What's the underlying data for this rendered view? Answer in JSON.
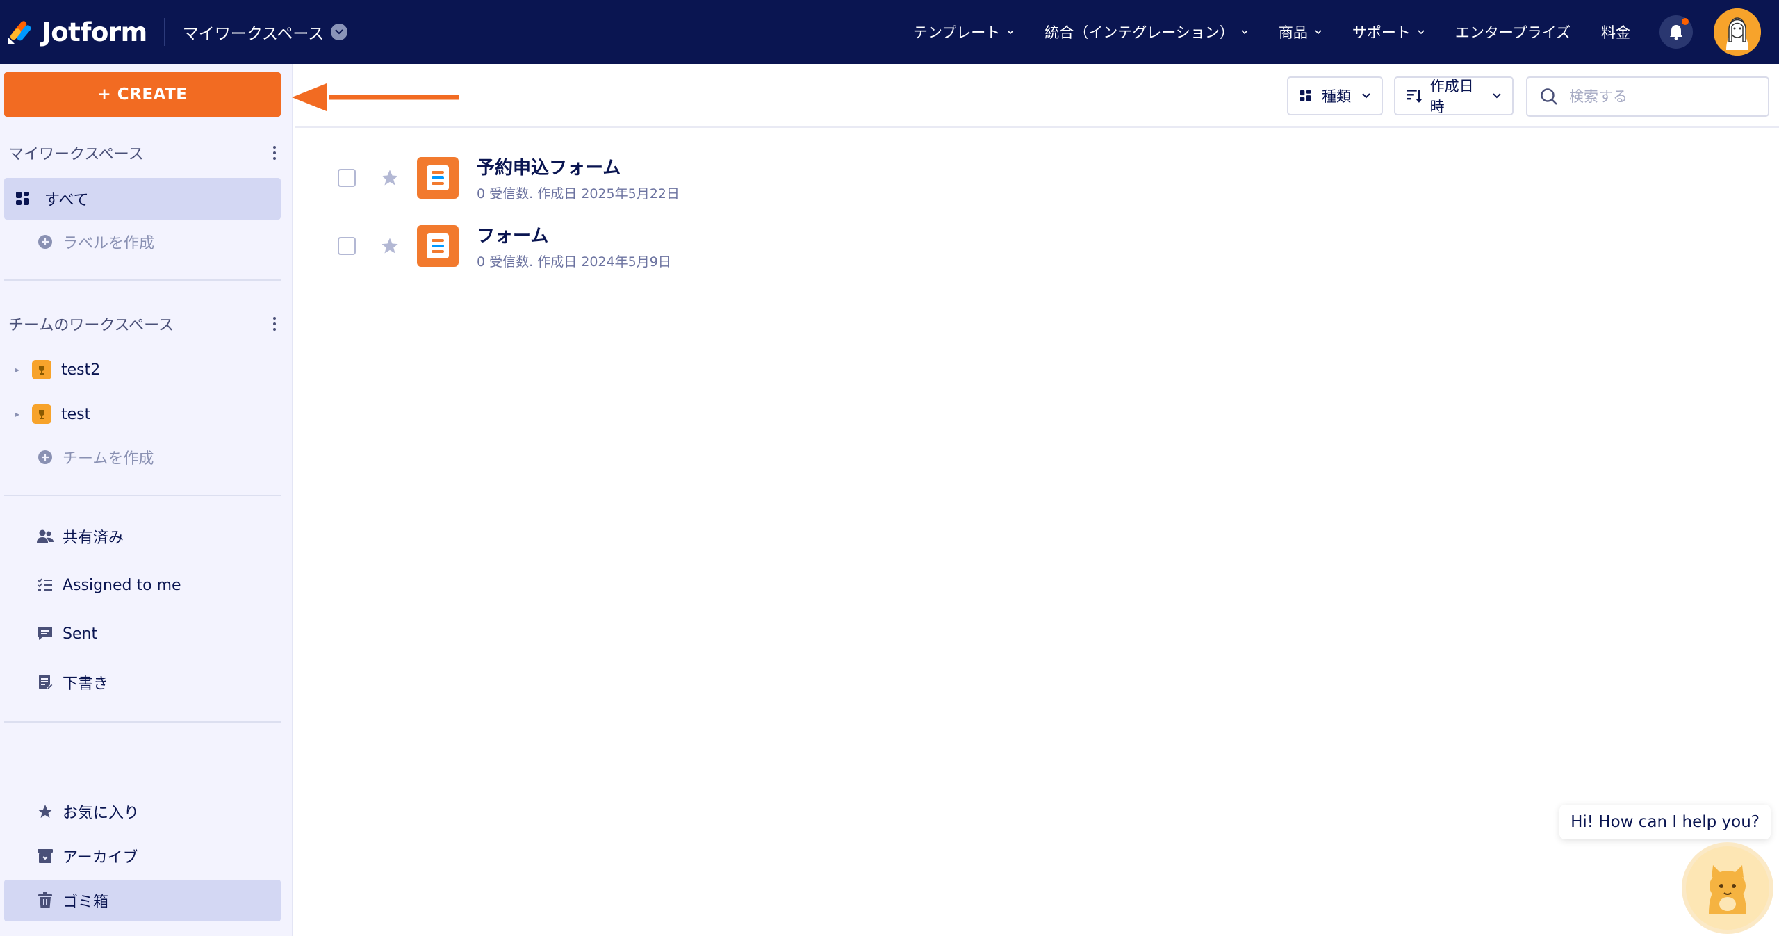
{
  "topnav": {
    "logo_text": "Jotform",
    "workspace_label": "マイワークスペース",
    "items": [
      {
        "label": "テンプレート"
      },
      {
        "label": "統合（インテグレーション）"
      },
      {
        "label": "商品"
      },
      {
        "label": "サポート"
      },
      {
        "label": "エンタープライズ"
      },
      {
        "label": "料金"
      }
    ]
  },
  "sidebar": {
    "create_label": "+ CREATE",
    "my_workspace_heading": "マイワークスペース",
    "all_label": "すべて",
    "create_label_link": "ラベルを作成",
    "team_workspace_heading": "チームのワークスペース",
    "teams": [
      {
        "name": "test2"
      },
      {
        "name": "test"
      }
    ],
    "create_team_link": "チームを作成",
    "shared_label": "共有済み",
    "assigned_label": "Assigned to me",
    "sent_label": "Sent",
    "drafts_label": "下書き",
    "favorites_label": "お気に入り",
    "archive_label": "アーカイブ",
    "trash_label": "ゴミ箱"
  },
  "toolbar": {
    "type_filter_label": "種類",
    "sort_label": "作成日時",
    "search_placeholder": "検索する"
  },
  "forms": [
    {
      "title": "予約申込フォーム",
      "meta": "0 受信数. 作成日 2025年5月22日"
    },
    {
      "title": "フォーム",
      "meta": "0 受信数. 作成日 2024年5月9日"
    }
  ],
  "chat": {
    "bubble_text": "Hi! How can I help you?"
  },
  "colors": {
    "nav_bg": "#0a1551",
    "accent": "#f26b22",
    "sidebar_bg": "#f3f3fe",
    "active_item": "#d3d7f3"
  }
}
